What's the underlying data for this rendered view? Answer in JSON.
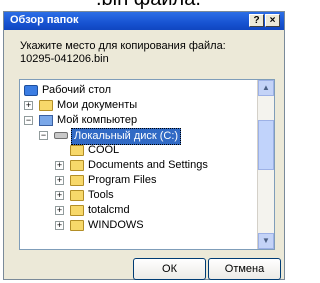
{
  "background_text": ".bin файла.",
  "dialog": {
    "title": "Обзор папок",
    "help_label": "?",
    "close_label": "×",
    "instruction_line1": "Укажите место для копирования файла:",
    "instruction_line2": "10295-041206.bin",
    "ok_label": "ОК",
    "cancel_label": "Отмена"
  },
  "tree": {
    "desktop": "Рабочий стол",
    "my_documents": "Мои документы",
    "my_computer": "Мой компьютер",
    "local_disk": "Локальный диск (C:)",
    "folders": [
      "COOL",
      "Documents and Settings",
      "Program Files",
      "Tools",
      "totalcmd",
      "WINDOWS"
    ]
  },
  "colors": {
    "selection": "#316ac5",
    "titlebar": "#1753d2",
    "folder": "#f7d86a"
  }
}
